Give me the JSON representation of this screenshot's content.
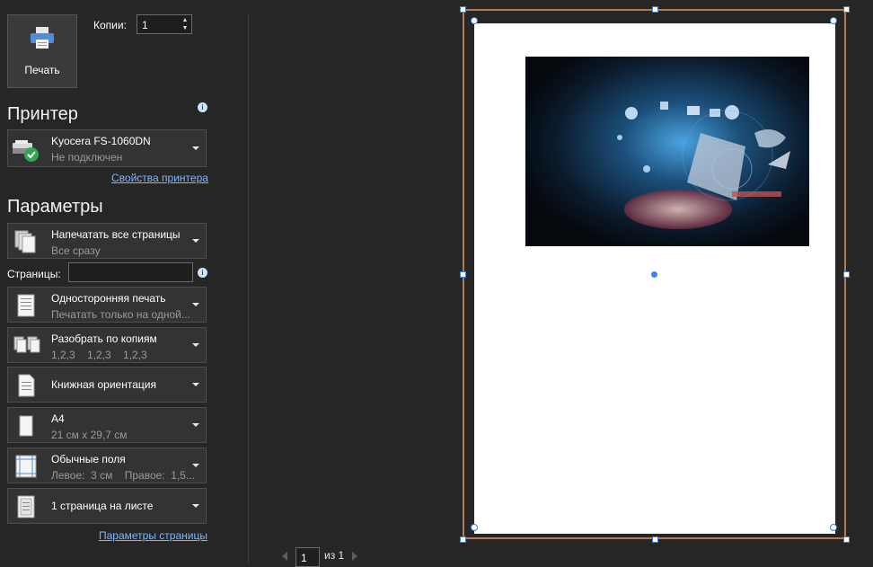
{
  "print": {
    "label": "Печать"
  },
  "copies": {
    "label": "Копии:",
    "value": "1"
  },
  "printer": {
    "heading": "Принтер",
    "name": "Kyocera FS-1060DN",
    "status": "Не подключен",
    "properties_link": "Свойства принтера"
  },
  "settings": {
    "heading": "Параметры",
    "print_what": {
      "title": "Напечатать все страницы",
      "subtitle": "Все сразу"
    },
    "pages_label": "Страницы:",
    "pages_value": "",
    "sides": {
      "title": "Односторонняя печать",
      "subtitle": "Печатать только на одной..."
    },
    "collate": {
      "title": "Разобрать по копиям",
      "subtitle": "1,2,3    1,2,3    1,2,3"
    },
    "orientation": {
      "title": "Книжная ориентация"
    },
    "paper": {
      "title": "A4",
      "subtitle": "21 см x 29,7 см"
    },
    "margins": {
      "title": "Обычные поля",
      "subtitle": "Левое:  3 см    Правое:  1,5..."
    },
    "per_sheet": {
      "title": "1 страница на листе"
    },
    "page_setup_link": "Параметры страницы"
  },
  "preview_nav": {
    "current_page": "1",
    "of_label": "из 1"
  },
  "colors": {
    "background": "#262626",
    "link": "#7fb7ff",
    "selection_frame": "#b07a55",
    "handle_border": "#3f7fd6"
  }
}
